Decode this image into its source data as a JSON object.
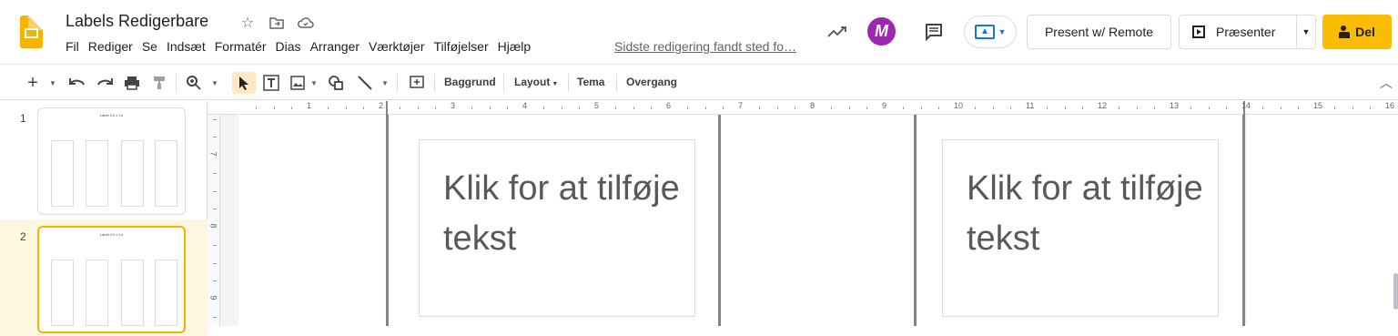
{
  "header": {
    "title": "Labels Redigerbare",
    "menu": [
      "Fil",
      "Rediger",
      "Se",
      "Indsæt",
      "Formatér",
      "Dias",
      "Arranger",
      "Værktøjer",
      "Tilføjelser",
      "Hjælp"
    ],
    "last_edit": "Sidste redigering fandt sted fo…",
    "avatar_letter": "M",
    "present_remote_label": "Present w/ Remote",
    "present_label": "Præsenter",
    "share_label": "Del"
  },
  "toolbar": {
    "background_label": "Baggrund",
    "layout_label": "Layout",
    "theme_label": "Tema",
    "transition_label": "Overgang"
  },
  "filmstrip": {
    "slides": [
      {
        "number": "1",
        "title": "Label 4.0 x 14"
      },
      {
        "number": "2",
        "title": "Label 4.0 x 14"
      }
    ]
  },
  "ruler": {
    "h_labels": [
      "1",
      "2",
      "3",
      "4",
      "5",
      "6",
      "7",
      "8",
      "9",
      "10",
      "11",
      "12",
      "13",
      "14",
      "15",
      "16"
    ],
    "v_labels": [
      "7",
      "8",
      "9"
    ]
  },
  "slide": {
    "placeholder_1": "Klik for at tilføje tekst",
    "placeholder_2": "Klik for at tilføje tekst"
  },
  "colors": {
    "accent": "#fbbc04",
    "logo": "#f4b400",
    "avatar": "#9c27b0",
    "blue": "#1a73e8"
  }
}
